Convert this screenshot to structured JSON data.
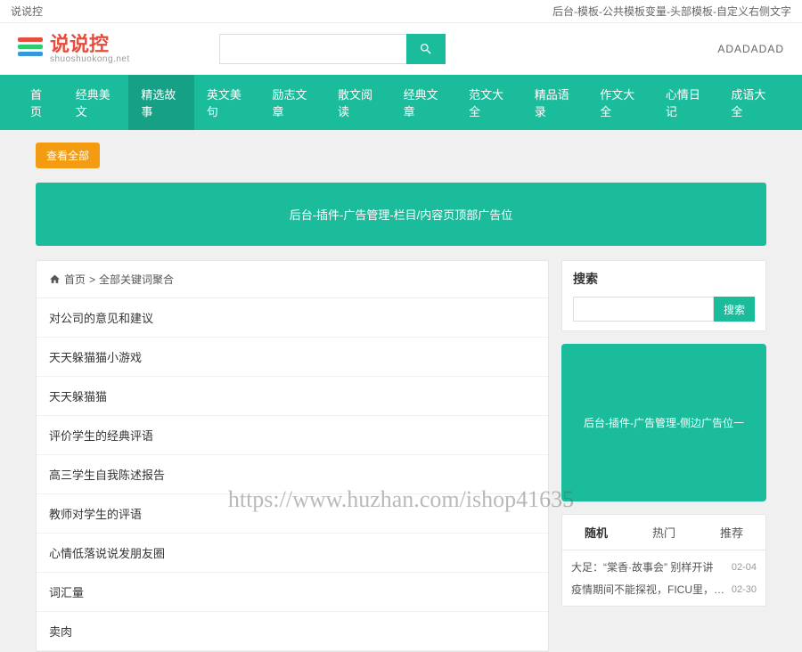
{
  "topbar": {
    "left": "说说控",
    "right": "后台-模板-公共模板变量-头部模板-自定义右侧文字"
  },
  "logo": {
    "name": "说说控",
    "sub": "shuoshuokong.net"
  },
  "search": {
    "placeholder": ""
  },
  "header_ad": "ADADADAD",
  "nav": [
    "首页",
    "经典美文",
    "精选故事",
    "英文美句",
    "励志文章",
    "散文阅读",
    "经典文章",
    "范文大全",
    "精品语录",
    "作文大全",
    "心情日记",
    "成语大全"
  ],
  "nav_active_index": 2,
  "filter_btn": "查看全部",
  "banner_ad": "后台-插件-广告管理-栏目/内容页顶部广告位",
  "breadcrumb": {
    "home": "首页",
    "sep": ">",
    "current": "全部关键词聚合"
  },
  "list": [
    "对公司的意见和建议",
    "天天躲猫猫小游戏",
    "天天躲猫猫",
    "评价学生的经典评语",
    "高三学生自我陈述报告",
    "教师对学生的评语",
    "心情低落说说发朋友圈",
    "词汇量",
    "卖肉"
  ],
  "sidebar": {
    "search_title": "搜索",
    "search_btn": "搜索",
    "ad_text": "后台-插件-广告管理-侧边广告位一",
    "tabs": [
      "随机",
      "热门",
      "推荐"
    ],
    "news": [
      {
        "title": "大足：“棠香·故事会” 别样开讲",
        "date": "02-04"
      },
      {
        "title": "疫情期间不能探视，FICU里，衢州这名护",
        "date": "02-30"
      }
    ]
  },
  "watermark": "https://www.huzhan.com/ishop41635"
}
